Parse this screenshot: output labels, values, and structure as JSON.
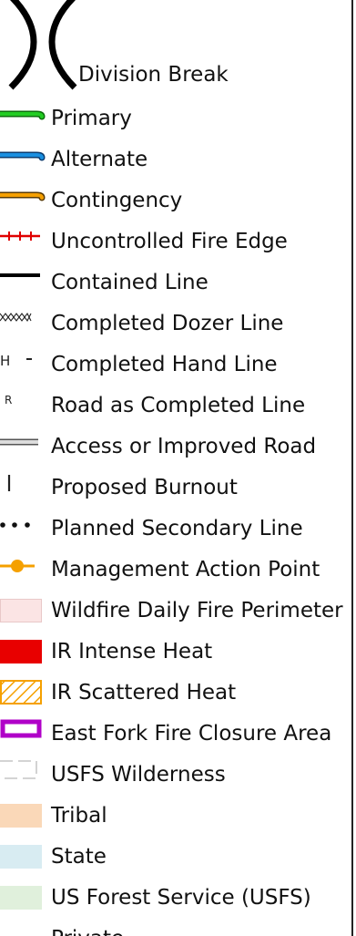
{
  "legend": {
    "division_break": "Division Break",
    "primary": "Primary",
    "alternate": "Alternate",
    "contingency": "Contingency",
    "uncontrolled": "Uncontrolled Fire Edge",
    "contained": "Contained Line",
    "dozer": "Completed Dozer Line",
    "hand": "Completed Hand Line",
    "road_completed": "Road as Completed Line",
    "access_road": "Access or Improved Road",
    "burnout": "Proposed Burnout",
    "secondary": "Planned Secondary Line",
    "map_point": "Management Action Point",
    "perimeter": "Wildfire Daily Fire Perimeter",
    "intense_heat": "IR Intense Heat",
    "scattered_heat": "IR Scattered Heat",
    "closure": "East Fork Fire Closure Area",
    "wilderness": "USFS Wilderness",
    "tribal": "Tribal",
    "state": "State",
    "usfs": "US Forest Service (USFS)",
    "private": "Private",
    "hand_symbol": "H",
    "road_symbol": "R"
  },
  "colors": {
    "primary": "#22cc22",
    "alternate": "#1a8fe0",
    "contingency": "#f5a000",
    "uncontrolled": "#e00000",
    "intense_heat": "#e80000",
    "scattered_heat": "#f5a000",
    "closure": "#b000c8",
    "perimeter": "#fbe4e4",
    "tribal": "#fad8b8",
    "state": "#d8ecf2",
    "usfs": "#e0f0dc"
  }
}
